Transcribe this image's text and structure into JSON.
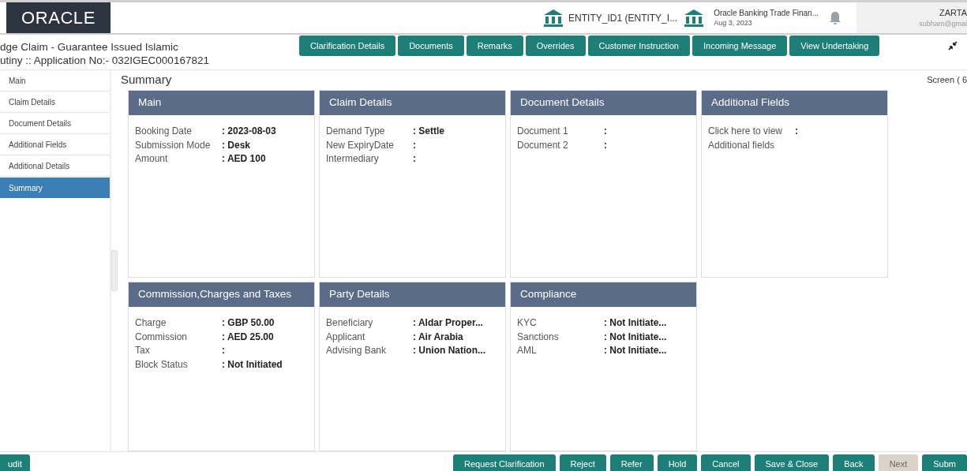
{
  "header": {
    "logo": "ORACLE",
    "entity": "ENTITY_ID1  (ENTITY_I...",
    "branch": "Oracle Banking Trade Finan...",
    "date": "Aug 3, 2023",
    "user_name": "ZARTA",
    "user_email": "subham@gmai"
  },
  "page": {
    "title": "dge Claim - Guarantee Issued Islamic",
    "application": "utiny ::  Application No:- 032IGEC000167821"
  },
  "tabs": [
    "Clarification Details",
    "Documents",
    "Remarks",
    "Overrides",
    "Customer Instruction",
    "Incoming Message",
    "View Undertaking"
  ],
  "sidebar": {
    "items": [
      {
        "label": "Main",
        "selected": false
      },
      {
        "label": "Claim Details",
        "selected": false
      },
      {
        "label": "Document Details",
        "selected": false
      },
      {
        "label": "Additional Fields",
        "selected": false
      },
      {
        "label": "Additional Details",
        "selected": false
      },
      {
        "label": "Summary",
        "selected": true
      }
    ]
  },
  "summary": {
    "heading": "Summary",
    "screen_label": "Screen ( 6"
  },
  "cards": [
    {
      "title": "Main",
      "rows": [
        {
          "label": "Booking Date",
          "value": ": 2023-08-03"
        },
        {
          "label": "Submission Mode",
          "value": ": Desk"
        },
        {
          "label": "Amount",
          "value": ": AED 100"
        }
      ]
    },
    {
      "title": "Claim Details",
      "rows": [
        {
          "label": "Demand Type",
          "value": ": Settle"
        },
        {
          "label": "New ExpiryDate",
          "value": ":"
        },
        {
          "label": "Intermediary",
          "value": ":"
        }
      ]
    },
    {
      "title": "Document Details",
      "rows": [
        {
          "label": "Document 1",
          "value": ":"
        },
        {
          "label": "Document 2",
          "value": ":"
        }
      ]
    },
    {
      "title": "Additional Fields",
      "rows": [
        {
          "label": "Click here to view Additional fields",
          "value": ":"
        }
      ]
    },
    {
      "title": "Commission,Charges and Taxes",
      "rows": [
        {
          "label": "Charge",
          "value": ": GBP  50.00"
        },
        {
          "label": "Commission",
          "value": ": AED  25.00"
        },
        {
          "label": "Tax",
          "value": ":"
        },
        {
          "label": "Block Status",
          "value": ": Not Initiated"
        }
      ]
    },
    {
      "title": "Party Details",
      "rows": [
        {
          "label": "Beneficiary",
          "value": ": Aldar Proper..."
        },
        {
          "label": "Applicant",
          "value": ": Air Arabia"
        },
        {
          "label": "Advising Bank",
          "value": ": Union Nation..."
        }
      ]
    },
    {
      "title": "Compliance",
      "rows": [
        {
          "label": "KYC",
          "value": ": Not Initiate..."
        },
        {
          "label": "Sanctions",
          "value": ": Not Initiate..."
        },
        {
          "label": "AML",
          "value": ": Not Initiate..."
        }
      ]
    }
  ],
  "footer": {
    "left_button": "udit",
    "buttons": [
      {
        "label": "Request Clarification",
        "disabled": false
      },
      {
        "label": "Reject",
        "disabled": false
      },
      {
        "label": "Refer",
        "disabled": false
      },
      {
        "label": "Hold",
        "disabled": false
      },
      {
        "label": "Cancel",
        "disabled": false
      },
      {
        "label": "Save & Close",
        "disabled": false
      },
      {
        "label": "Back",
        "disabled": false
      },
      {
        "label": "Next",
        "disabled": true
      },
      {
        "label": "Subm",
        "disabled": false
      }
    ]
  }
}
